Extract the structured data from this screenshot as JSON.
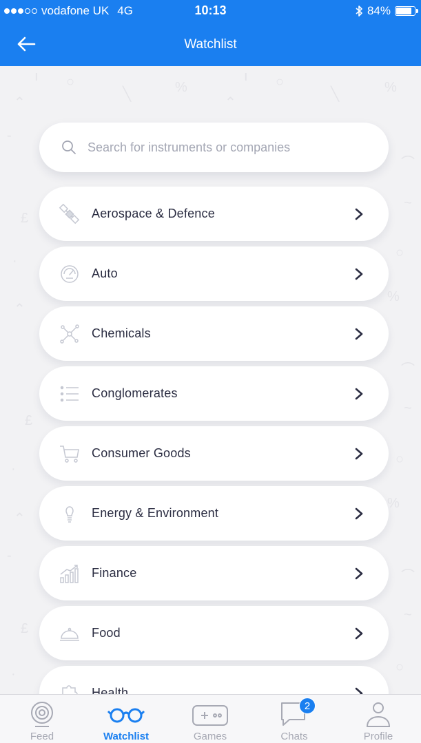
{
  "status_bar": {
    "carrier": "vodafone UK",
    "network": "4G",
    "time": "10:13",
    "battery": "84%",
    "battery_level": 0.84
  },
  "header": {
    "title": "Watchlist"
  },
  "search": {
    "placeholder": "Search for instruments or companies"
  },
  "categories": [
    {
      "label": "Aerospace & Defence",
      "icon": "satellite-icon"
    },
    {
      "label": "Auto",
      "icon": "speedometer-icon"
    },
    {
      "label": "Chemicals",
      "icon": "molecule-icon"
    },
    {
      "label": "Conglomerates",
      "icon": "bullet-list-icon"
    },
    {
      "label": "Consumer Goods",
      "icon": "shopping-cart-icon"
    },
    {
      "label": "Energy & Environment",
      "icon": "lightbulb-icon"
    },
    {
      "label": "Finance",
      "icon": "growth-chart-icon"
    },
    {
      "label": "Food",
      "icon": "cloche-icon"
    },
    {
      "label": "Health",
      "icon": "puzzle-icon"
    }
  ],
  "tabs": [
    {
      "label": "Feed",
      "icon": "feed-icon",
      "active": false
    },
    {
      "label": "Watchlist",
      "icon": "glasses-icon",
      "active": true
    },
    {
      "label": "Games",
      "icon": "gamepad-icon",
      "active": false
    },
    {
      "label": "Chats",
      "icon": "chat-bubble-icon",
      "active": false,
      "badge": "2"
    },
    {
      "label": "Profile",
      "icon": "person-icon",
      "active": false
    }
  ],
  "colors": {
    "accent": "#1a7ff0",
    "background": "#f2f2f4",
    "text": "#2b2d42",
    "muted": "#a7a9b4"
  }
}
